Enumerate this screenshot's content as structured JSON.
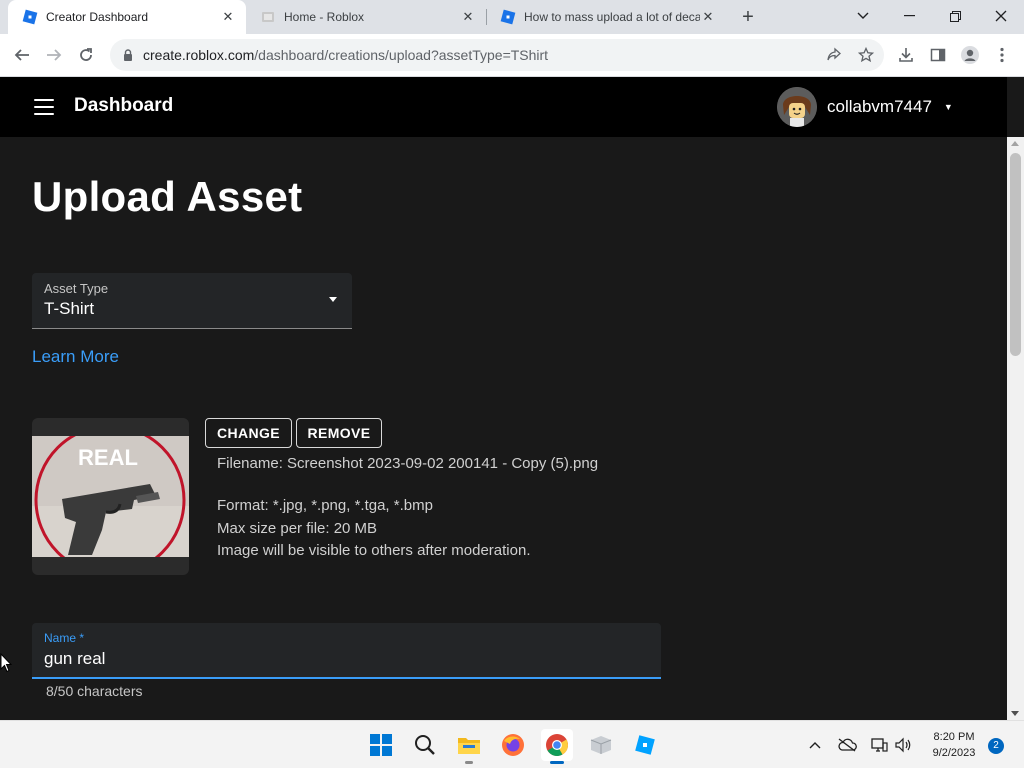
{
  "browser": {
    "tabs": [
      {
        "title": "Creator Dashboard",
        "active": true
      },
      {
        "title": "Home - Roblox",
        "active": false
      },
      {
        "title": "How to mass upload a lot of decals",
        "active": false
      }
    ],
    "url_host": "create.roblox.com",
    "url_path": "/dashboard/creations/upload?assetType=TShirt"
  },
  "header": {
    "title": "Dashboard",
    "username": "collabvm7447"
  },
  "main": {
    "heading": "Upload Asset",
    "asset_type": {
      "label": "Asset Type",
      "value": "T-Shirt"
    },
    "learn_more": "Learn More",
    "thumbnail": {
      "overlay_text": "REAL"
    },
    "change_label": "CHANGE",
    "remove_label": "REMOVE",
    "filename": "Filename: Screenshot 2023-09-02 200141 - Copy (5).png",
    "format": "Format: *.jpg, *.png, *.tga, *.bmp",
    "max_size": "Max size per file: 20 MB",
    "moderation_note": "Image will be visible to others after moderation.",
    "name_field": {
      "label": "Name *",
      "value": "gun real",
      "char_count": "8/50 characters"
    }
  },
  "taskbar": {
    "time": "8:20 PM",
    "date": "9/2/2023",
    "notification_count": "2"
  },
  "colors": {
    "accent": "#3a9df8",
    "page_bg": "#191919",
    "topbar_bg": "#000000"
  }
}
